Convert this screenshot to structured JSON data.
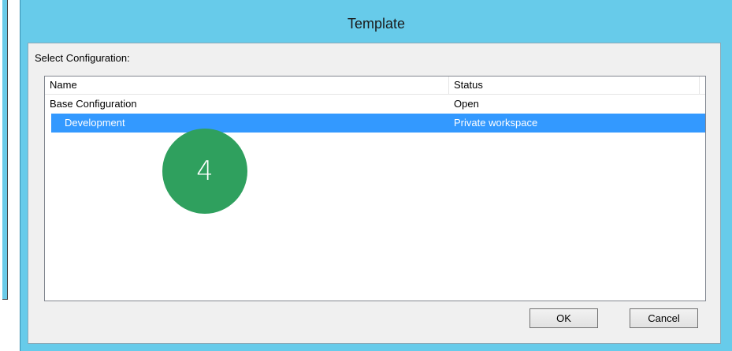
{
  "dialog": {
    "title": "Template",
    "select_label": "Select Configuration:",
    "columns": {
      "name": "Name",
      "status": "Status"
    },
    "rows": [
      {
        "name": "Base Configuration",
        "status": "Open",
        "selected": false
      },
      {
        "name": "Development",
        "status": "Private workspace",
        "selected": true
      }
    ],
    "ok_label": "OK",
    "cancel_label": "Cancel"
  },
  "callout": {
    "step_number": "4",
    "color": "#2fa05e"
  },
  "colors": {
    "titlebar": "#67cbea",
    "selection": "#3399ff"
  }
}
